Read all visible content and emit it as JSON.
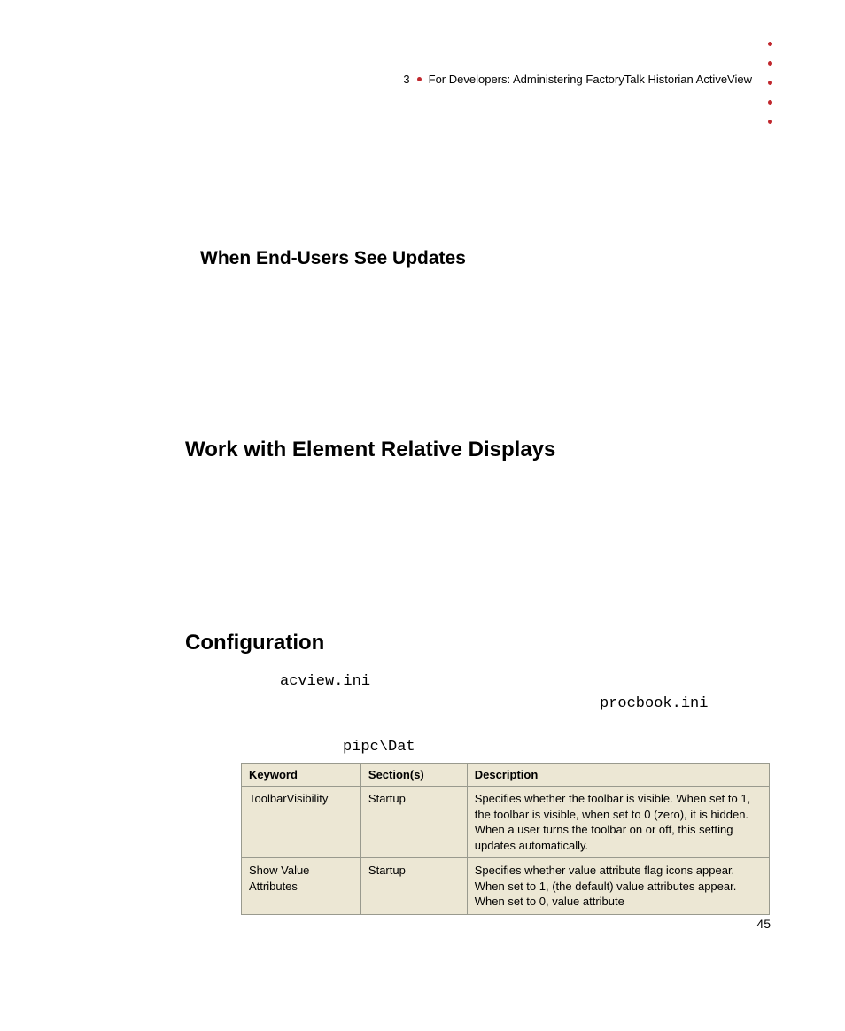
{
  "header": {
    "chapter_num": "3",
    "chapter_title": "For Developers: Administering FactoryTalk Historian ActiveView"
  },
  "sections": {
    "sub1": "When End-Users See Updates",
    "main1": "Work with Element Relative Displays",
    "main2": "Configuration"
  },
  "config": {
    "file1": "acview.ini",
    "file2": "procbook.ini",
    "path": "pipc\\Dat"
  },
  "table": {
    "headers": {
      "keyword": "Keyword",
      "section": "Section(s)",
      "description": "Description"
    },
    "rows": [
      {
        "keyword": "ToolbarVisibility",
        "section": "Startup",
        "description": "Specifies whether the toolbar is visible. When set to 1, the toolbar is visible, when set to 0 (zero), it is hidden. When a user turns the toolbar on or off, this setting updates automatically."
      },
      {
        "keyword": "Show Value Attributes",
        "section": "Startup",
        "description": "Specifies whether value attribute flag icons appear. When set to 1, (the default) value attributes appear. When set to 0, value attribute"
      }
    ]
  },
  "page_number": "45"
}
